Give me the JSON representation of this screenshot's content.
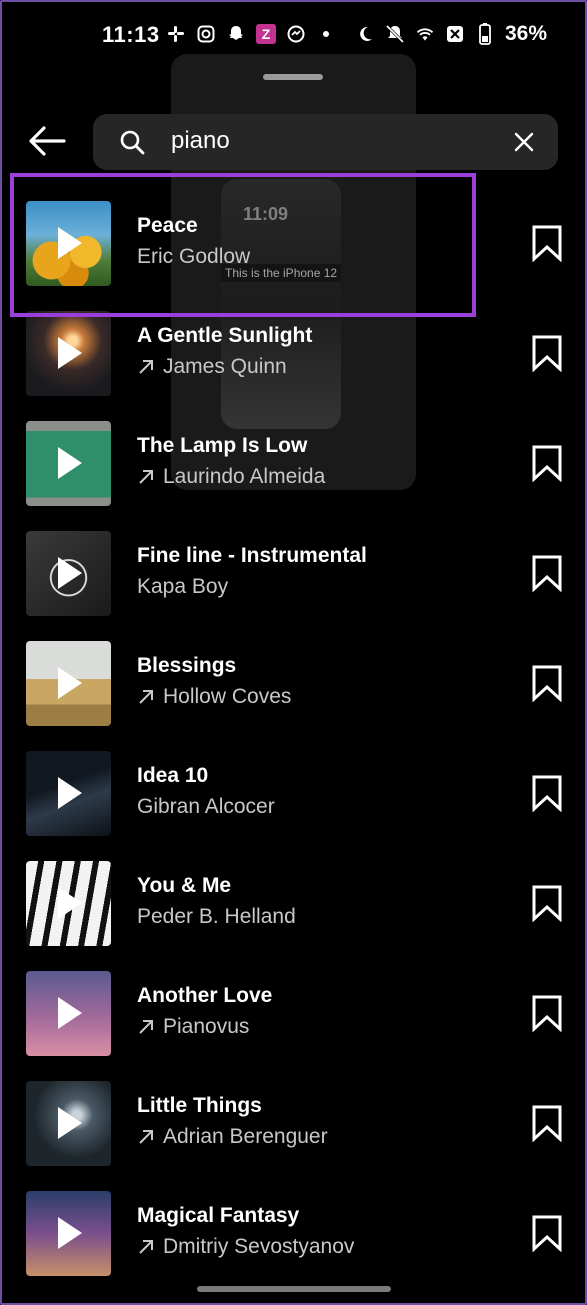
{
  "status_bar": {
    "time": "11:13",
    "left_icons": [
      "slack-icon",
      "instagram-icon",
      "snapchat-icon",
      "z-app-icon",
      "messenger-icon",
      "dot-icon"
    ],
    "right_icons": [
      "do-not-disturb-icon",
      "mute-icon",
      "wifi-icon",
      "no-sim-icon",
      "battery-icon"
    ],
    "battery": "36%"
  },
  "overlay": {
    "phone_time": "11:09",
    "phone_caption": "This is the iPhone 12"
  },
  "search": {
    "query": "piano"
  },
  "colors": {
    "highlight": "#9a3fd9",
    "background": "#000000",
    "search_bg": "#262626"
  },
  "results": [
    {
      "title": "Peace",
      "artist": "Eric Godlow",
      "trending": false
    },
    {
      "title": "A Gentle Sunlight",
      "artist": "James Quinn",
      "trending": true
    },
    {
      "title": "The Lamp Is Low",
      "artist": "Laurindo Almeida",
      "trending": true
    },
    {
      "title": "Fine line - Instrumental",
      "artist": "Kapa Boy",
      "trending": false
    },
    {
      "title": "Blessings",
      "artist": "Hollow Coves",
      "trending": true
    },
    {
      "title": "Idea 10",
      "artist": "Gibran Alcocer",
      "trending": false
    },
    {
      "title": "You & Me",
      "artist": "Peder B. Helland",
      "trending": false
    },
    {
      "title": "Another Love",
      "artist": "Pianovus",
      "trending": true
    },
    {
      "title": "Little Things",
      "artist": "Adrian Berenguer",
      "trending": true
    },
    {
      "title": "Magical Fantasy",
      "artist": "Dmitriy Sevostyanov",
      "trending": true
    }
  ]
}
